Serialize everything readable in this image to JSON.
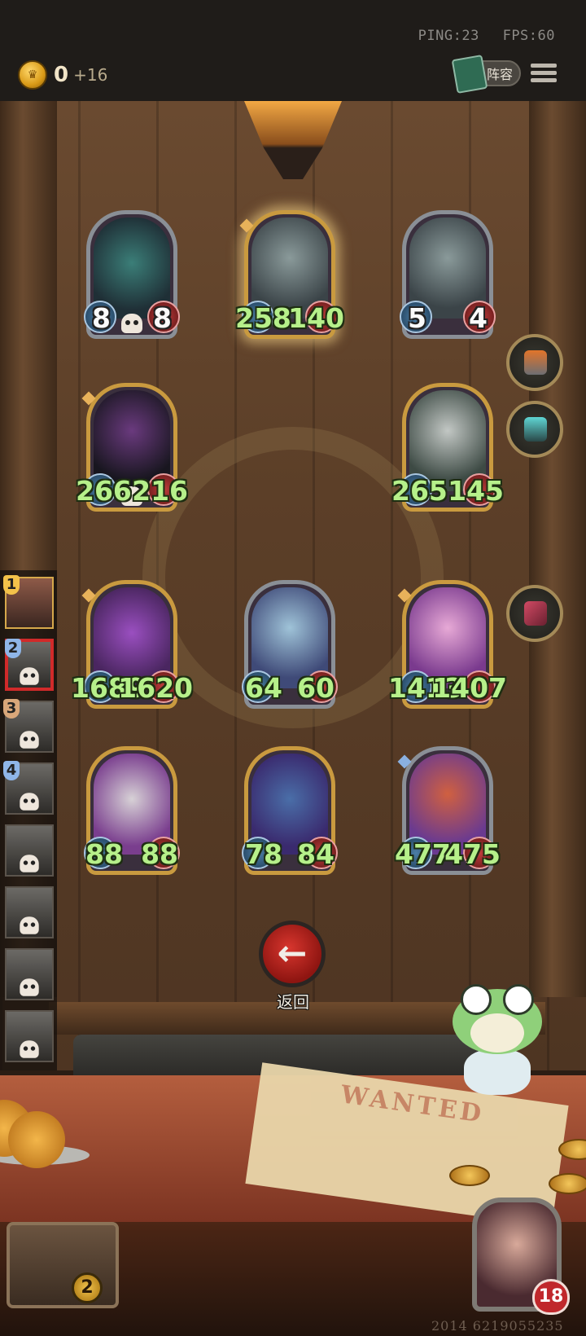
{
  "hud": {
    "ping": "PING:23",
    "fps": "FPS:60",
    "gold": "0",
    "gold_income": "+16",
    "lineup_label": "阵容"
  },
  "board": [
    {
      "id": "urn",
      "atk": "8",
      "hp": "8",
      "stat_color": "white",
      "skull": true
    },
    {
      "id": "nun-gold",
      "atk": "258",
      "hp": "140",
      "stat_color": "green",
      "highlight": true
    },
    {
      "id": "nun",
      "atk": "5",
      "hp": "4",
      "stat_color": "white"
    },
    {
      "id": "dark-knight",
      "atk": "266",
      "hp": "216",
      "stat_color": "green",
      "skull": true
    },
    {
      "id": "reaper",
      "atk": "265",
      "hp": "145",
      "stat_color": "green"
    },
    {
      "id": "pirate-cat",
      "atk": "1689",
      "hp": "1620",
      "stat_color": "green"
    },
    {
      "id": "elf-mage",
      "atk": "64",
      "hp": "60",
      "stat_color": "green"
    },
    {
      "id": "pink-girl",
      "atk": "1413",
      "hp": "1407",
      "stat_color": "green"
    },
    {
      "id": "dog",
      "atk": "88",
      "hp": "88",
      "stat_color": "green"
    },
    {
      "id": "imp",
      "atk": "78",
      "hp": "84",
      "stat_color": "green"
    },
    {
      "id": "dragon-girl",
      "atk": "477",
      "hp": "475",
      "stat_color": "green"
    }
  ],
  "standings": [
    {
      "rank": "1",
      "is_player": true
    },
    {
      "rank": "2",
      "selected": true,
      "eliminated": true
    },
    {
      "rank": "3",
      "eliminated": true
    },
    {
      "rank": "4",
      "eliminated": true
    },
    {
      "rank": "",
      "eliminated": true
    },
    {
      "rank": "",
      "eliminated": true
    },
    {
      "rank": "",
      "eliminated": true
    },
    {
      "rank": "",
      "eliminated": true
    }
  ],
  "back_label": "返回",
  "wanted_text": "WANTED",
  "chest_count": "2",
  "player_health": "18",
  "session_id": "2014 6219055235",
  "colors": {
    "stat_green": "#b6f08a",
    "gold_frame": "#c99a3f",
    "back_red": "#c62a22"
  }
}
